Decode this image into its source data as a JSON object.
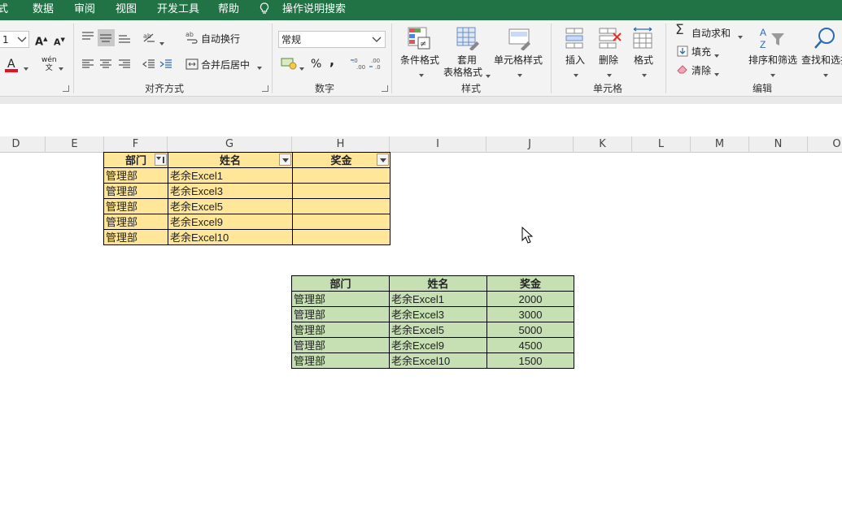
{
  "menu": [
    "式",
    "数据",
    "审阅",
    "视图",
    "开发工具",
    "帮助",
    "操作说明搜索"
  ],
  "ribbon": {
    "font_size_value": "1",
    "wrap_text": "自动换行",
    "merge_center": "合并后居中",
    "alignment_group": "对齐方式",
    "number_format": "常规",
    "percent": "%",
    "comma": ",",
    "number_group": "数字",
    "conditional_format": "条件格式",
    "table_format_line1": "套用",
    "table_format_line2": "表格格式",
    "cell_styles": "单元格样式",
    "styles_group": "样式",
    "insert": "插入",
    "delete": "删除",
    "format": "格式",
    "cells_group": "单元格",
    "autosum": "自动求和",
    "fill": "填充",
    "clear": "清除",
    "sort_filter": "排序和筛选",
    "find_select": "查找和选择",
    "editing_group": "编辑"
  },
  "columns": [
    "D",
    "E",
    "F",
    "G",
    "H",
    "I",
    "J",
    "K",
    "L",
    "M",
    "N",
    "O"
  ],
  "filtered_table": {
    "headers": [
      "部门",
      "姓名",
      "奖金"
    ],
    "rows": [
      [
        "管理部",
        "老余Excel1",
        ""
      ],
      [
        "管理部",
        "老余Excel3",
        ""
      ],
      [
        "管理部",
        "老余Excel5",
        ""
      ],
      [
        "管理部",
        "老余Excel9",
        ""
      ],
      [
        "管理部",
        "老余Excel10",
        ""
      ]
    ]
  },
  "source_table": {
    "headers": [
      "部门",
      "姓名",
      "奖金"
    ],
    "rows": [
      [
        "管理部",
        "老余Excel1",
        "2000"
      ],
      [
        "管理部",
        "老余Excel3",
        "3000"
      ],
      [
        "管理部",
        "老余Excel5",
        "5000"
      ],
      [
        "管理部",
        "老余Excel9",
        "4500"
      ],
      [
        "管理部",
        "老余Excel10",
        "1500"
      ]
    ]
  },
  "colors": {
    "menu_bar": "#217346",
    "filtered_fill": "#ffe699",
    "source_fill": "#c6e0b4",
    "font_color_bar": "#e81123"
  }
}
